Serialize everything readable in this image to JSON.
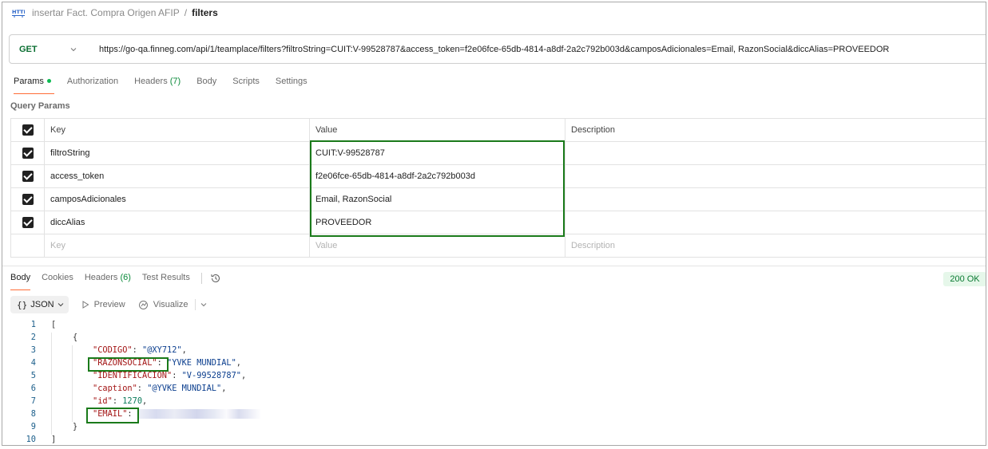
{
  "breadcrumb": {
    "icon": "http-icon",
    "collection": "insertar Fact. Compra Origen AFIP",
    "separator": "/",
    "request": "filters"
  },
  "request": {
    "method": "GET",
    "url": "https://go-qa.finneg.com/api/1/teamplace/filters?filtroString=CUIT:V-99528787&access_token=f2e06fce-65db-4814-a8df-2a2c792b003d&camposAdicionales=Email, RazonSocial&diccAlias=PROVEEDOR"
  },
  "request_tabs": [
    {
      "label": "Params",
      "count": ""
    },
    {
      "label": "Authorization",
      "count": ""
    },
    {
      "label": "Headers",
      "count": "(7)"
    },
    {
      "label": "Body",
      "count": ""
    },
    {
      "label": "Scripts",
      "count": ""
    },
    {
      "label": "Settings",
      "count": ""
    }
  ],
  "query_params": {
    "title": "Query Params",
    "headers": {
      "key": "Key",
      "value": "Value",
      "description": "Description"
    },
    "rows": [
      {
        "key": "filtroString",
        "value": "CUIT:V-99528787",
        "description": ""
      },
      {
        "key": "access_token",
        "value": "f2e06fce-65db-4814-a8df-2a2c792b003d",
        "description": ""
      },
      {
        "key": "camposAdicionales",
        "value": "Email, RazonSocial",
        "description": ""
      },
      {
        "key": "diccAlias",
        "value": "PROVEEDOR",
        "description": ""
      }
    ],
    "placeholder": {
      "key": "Key",
      "value": "Value",
      "description": "Description"
    }
  },
  "response_tabs": [
    {
      "label": "Body",
      "count": ""
    },
    {
      "label": "Cookies",
      "count": ""
    },
    {
      "label": "Headers",
      "count": "(6)"
    },
    {
      "label": "Test Results",
      "count": ""
    }
  ],
  "status": "200 OK",
  "format": {
    "selected": "JSON",
    "braces": "{}",
    "preview": "Preview",
    "visualize": "Visualize"
  },
  "code_lines": [
    {
      "n": "1",
      "indent": 0,
      "parts": [
        {
          "t": "[",
          "c": "pun"
        }
      ]
    },
    {
      "n": "2",
      "indent": 1,
      "parts": [
        {
          "t": "{",
          "c": "pun"
        }
      ]
    },
    {
      "n": "3",
      "indent": 2,
      "parts": [
        {
          "t": "\"CODIGO\"",
          "c": "key"
        },
        {
          "t": ": ",
          "c": "pun"
        },
        {
          "t": "\"@XY712\"",
          "c": "str"
        },
        {
          "t": ",",
          "c": "pun"
        }
      ]
    },
    {
      "n": "4",
      "indent": 2,
      "parts": [
        {
          "t": "\"RAZONSOCIAL\"",
          "c": "key"
        },
        {
          "t": ": ",
          "c": "pun"
        },
        {
          "t": "\"YVKE MUNDIAL\"",
          "c": "str"
        },
        {
          "t": ",",
          "c": "pun"
        }
      ]
    },
    {
      "n": "5",
      "indent": 2,
      "parts": [
        {
          "t": "\"IDENTIFICACION\"",
          "c": "key"
        },
        {
          "t": ": ",
          "c": "pun"
        },
        {
          "t": "\"V-99528787\"",
          "c": "str"
        },
        {
          "t": ",",
          "c": "pun"
        }
      ]
    },
    {
      "n": "6",
      "indent": 2,
      "parts": [
        {
          "t": "\"caption\"",
          "c": "key"
        },
        {
          "t": ": ",
          "c": "pun"
        },
        {
          "t": "\"@YVKE MUNDIAL\"",
          "c": "str"
        },
        {
          "t": ",",
          "c": "pun"
        }
      ]
    },
    {
      "n": "7",
      "indent": 2,
      "parts": [
        {
          "t": "\"id\"",
          "c": "key"
        },
        {
          "t": ": ",
          "c": "pun"
        },
        {
          "t": "1270",
          "c": "num"
        },
        {
          "t": ",",
          "c": "pun"
        }
      ]
    },
    {
      "n": "8",
      "indent": 2,
      "parts": [
        {
          "t": "\"EMAIL\"",
          "c": "key"
        },
        {
          "t": ": ",
          "c": "pun"
        },
        {
          "t": "",
          "c": "blur"
        }
      ]
    },
    {
      "n": "9",
      "indent": 1,
      "parts": [
        {
          "t": "}",
          "c": "pun"
        }
      ]
    },
    {
      "n": "10",
      "indent": 0,
      "parts": [
        {
          "t": "]",
          "c": "pun"
        }
      ]
    }
  ],
  "colors": {
    "accent_tab": "#ff6c37",
    "method_get": "#0a6e31",
    "highlight_box": "#1a7a1a",
    "status_ok": "#0a7a32"
  }
}
